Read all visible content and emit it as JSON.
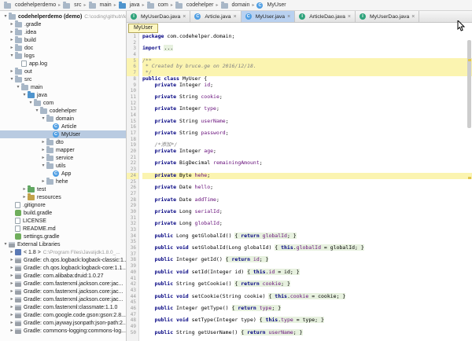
{
  "ui": {
    "close": "×",
    "collapsed": "▸",
    "expanded": "▾",
    "separator": "▸"
  },
  "colors": {
    "tab_selected": "#b9d1f0",
    "tree_selection": "#b9cbe1",
    "keyword": "#000080",
    "field": "#660e7a",
    "comment": "#808080",
    "line_highlight": "#fbf4b0",
    "fold_background": "#e7f1df"
  },
  "breadcrumb": {
    "items": [
      {
        "label": "codehelperdemo",
        "icon": "folder"
      },
      {
        "label": "src",
        "icon": "folder"
      },
      {
        "label": "main",
        "icon": "folder"
      },
      {
        "label": "java",
        "icon": "src"
      },
      {
        "label": "com",
        "icon": "pkg"
      },
      {
        "label": "codehelper",
        "icon": "pkg"
      },
      {
        "label": "domain",
        "icon": "pkg"
      },
      {
        "label": "MyUser",
        "icon": "class"
      }
    ]
  },
  "tabs": [
    {
      "label": "MyUserDao.java",
      "icon": "interface",
      "selected": false
    },
    {
      "label": "Article.java",
      "icon": "class",
      "selected": false
    },
    {
      "label": "MyUser.java",
      "icon": "class",
      "selected": true
    },
    {
      "label": "ArticleDao.java",
      "icon": "interface",
      "selected": false
    },
    {
      "label": "MyUserDao.java",
      "icon": "interface",
      "selected": false
    }
  ],
  "project": {
    "tree": [
      {
        "depth": 0,
        "state": "e",
        "icon": "folder",
        "label": "codehelperdemo (demo)",
        "sub": "C:\\coding\\github\\fe",
        "bold": true
      },
      {
        "depth": 1,
        "state": "c",
        "icon": "folder",
        "label": ".gradle"
      },
      {
        "depth": 1,
        "state": "c",
        "icon": "folder",
        "label": ".idea"
      },
      {
        "depth": 1,
        "state": "c",
        "icon": "folder",
        "label": "build"
      },
      {
        "depth": 1,
        "state": "c",
        "icon": "folder",
        "label": "doc"
      },
      {
        "depth": 1,
        "state": "e",
        "icon": "folder",
        "label": "logs"
      },
      {
        "depth": 2,
        "state": "n",
        "icon": "file",
        "label": "app.log"
      },
      {
        "depth": 1,
        "state": "c",
        "icon": "folder",
        "label": "out"
      },
      {
        "depth": 1,
        "state": "e",
        "icon": "folder",
        "label": "src"
      },
      {
        "depth": 2,
        "state": "e",
        "icon": "folder",
        "label": "main"
      },
      {
        "depth": 3,
        "state": "e",
        "icon": "src",
        "label": "java"
      },
      {
        "depth": 4,
        "state": "e",
        "icon": "pkg",
        "label": "com"
      },
      {
        "depth": 5,
        "state": "e",
        "icon": "pkg",
        "label": "codehelper"
      },
      {
        "depth": 6,
        "state": "e",
        "icon": "pkg",
        "label": "domain"
      },
      {
        "depth": 7,
        "state": "n",
        "icon": "class",
        "label": "Article"
      },
      {
        "depth": 7,
        "state": "n",
        "icon": "class",
        "label": "MyUser",
        "selected": true
      },
      {
        "depth": 6,
        "state": "c",
        "icon": "pkg",
        "label": "dto"
      },
      {
        "depth": 6,
        "state": "c",
        "icon": "pkg",
        "label": "mapper"
      },
      {
        "depth": 6,
        "state": "c",
        "icon": "pkg",
        "label": "service"
      },
      {
        "depth": 6,
        "state": "e",
        "icon": "pkg",
        "label": "utils"
      },
      {
        "depth": 7,
        "state": "n",
        "icon": "class",
        "label": "App"
      },
      {
        "depth": 6,
        "state": "c",
        "icon": "pkg",
        "label": "hehe"
      },
      {
        "depth": 3,
        "state": "c",
        "icon": "test",
        "label": "test"
      },
      {
        "depth": 3,
        "state": "c",
        "icon": "res",
        "label": "resources"
      },
      {
        "depth": 1,
        "state": "n",
        "icon": "file",
        "label": ".gitignore"
      },
      {
        "depth": 1,
        "state": "n",
        "icon": "gradle",
        "label": "build.gradle"
      },
      {
        "depth": 1,
        "state": "n",
        "icon": "file",
        "label": "LICENSE"
      },
      {
        "depth": 1,
        "state": "n",
        "icon": "file",
        "label": "README.md"
      },
      {
        "depth": 1,
        "state": "n",
        "icon": "gradle",
        "label": "settings.gradle"
      },
      {
        "depth": 0,
        "state": "e",
        "icon": "lib",
        "label": "External Libraries"
      },
      {
        "depth": 1,
        "state": "c",
        "icon": "jdk",
        "label": "< 1.8 >",
        "sub": "C:\\Program Files\\Java\\jdk1.8.0_..."
      },
      {
        "depth": 1,
        "state": "c",
        "icon": "lib",
        "label": "Gradle: ch.qos.logback:logback-classic:1..."
      },
      {
        "depth": 1,
        "state": "c",
        "icon": "lib",
        "label": "Gradle: ch.qos.logback:logback-core:1.1..."
      },
      {
        "depth": 1,
        "state": "c",
        "icon": "lib",
        "label": "Gradle: com.alibaba:druid:1.0.27"
      },
      {
        "depth": 1,
        "state": "c",
        "icon": "lib",
        "label": "Gradle: com.fasterxml.jackson.core:jac..."
      },
      {
        "depth": 1,
        "state": "c",
        "icon": "lib",
        "label": "Gradle: com.fasterxml.jackson.core:jac..."
      },
      {
        "depth": 1,
        "state": "c",
        "icon": "lib",
        "label": "Gradle: com.fasterxml.jackson.core:jac..."
      },
      {
        "depth": 1,
        "state": "c",
        "icon": "lib",
        "label": "Gradle: com.fasterxml:classmate:1.1.0"
      },
      {
        "depth": 1,
        "state": "c",
        "icon": "lib",
        "label": "Gradle: com.google.code.gson:gson:2.8..."
      },
      {
        "depth": 1,
        "state": "c",
        "icon": "lib",
        "label": "Gradle: com.jayway.jsonpath:json-path:2..."
      },
      {
        "depth": 1,
        "state": "c",
        "icon": "lib",
        "label": "Gradle: commons-logging:commons-log..."
      }
    ]
  },
  "editor": {
    "floating_label": "MyUser",
    "lines": [
      {
        "num": 1,
        "segs": [
          [
            "package",
            "kw"
          ],
          [
            " com.codehelper.domain;",
            "pl"
          ]
        ]
      },
      {
        "num": 2,
        "segs": []
      },
      {
        "num": 3,
        "segs": [
          [
            "import",
            "kw"
          ],
          [
            " ",
            "pl"
          ],
          [
            "...",
            "f"
          ]
        ]
      },
      {
        "num": 4,
        "segs": []
      },
      {
        "num": 5,
        "hl": true,
        "segs": [
          [
            "/**",
            "cmt"
          ]
        ]
      },
      {
        "num": 6,
        "hl": true,
        "segs": [
          [
            " * Created by bruce.ge on 2016/12/18.",
            "cmt"
          ]
        ]
      },
      {
        "num": 7,
        "hl": true,
        "segs": [
          [
            " */",
            "cmt"
          ]
        ]
      },
      {
        "num": 8,
        "segs": [
          [
            "public class",
            "kw"
          ],
          [
            " MyUser {",
            "pl"
          ]
        ]
      },
      {
        "num": 9,
        "segs": [
          [
            "    ",
            "pl"
          ],
          [
            "private",
            "kw"
          ],
          [
            " Integer ",
            "pl"
          ],
          [
            "id",
            "fld"
          ],
          [
            ";",
            "pl"
          ]
        ]
      },
      {
        "num": 10,
        "segs": []
      },
      {
        "num": 11,
        "segs": [
          [
            "    ",
            "pl"
          ],
          [
            "private",
            "kw"
          ],
          [
            " String ",
            "pl"
          ],
          [
            "cookie",
            "fld"
          ],
          [
            ";",
            "pl"
          ]
        ]
      },
      {
        "num": 12,
        "segs": []
      },
      {
        "num": 13,
        "segs": [
          [
            "    ",
            "pl"
          ],
          [
            "private",
            "kw"
          ],
          [
            " Integer ",
            "pl"
          ],
          [
            "type",
            "fld"
          ],
          [
            ";",
            "pl"
          ]
        ]
      },
      {
        "num": 14,
        "segs": []
      },
      {
        "num": 15,
        "segs": [
          [
            "    ",
            "pl"
          ],
          [
            "private",
            "kw"
          ],
          [
            " String ",
            "pl"
          ],
          [
            "userName",
            "fld"
          ],
          [
            ";",
            "pl"
          ]
        ]
      },
      {
        "num": 16,
        "segs": []
      },
      {
        "num": 17,
        "segs": [
          [
            "    ",
            "pl"
          ],
          [
            "private",
            "kw"
          ],
          [
            " String ",
            "pl"
          ],
          [
            "password",
            "fld"
          ],
          [
            ";",
            "pl"
          ]
        ]
      },
      {
        "num": 18,
        "segs": []
      },
      {
        "num": 19,
        "segs": [
          [
            "    ",
            "pl"
          ],
          [
            "/*添加*/",
            "cmt"
          ]
        ]
      },
      {
        "num": 20,
        "segs": [
          [
            "    ",
            "pl"
          ],
          [
            "private",
            "kw"
          ],
          [
            " Integer ",
            "pl"
          ],
          [
            "age",
            "fld"
          ],
          [
            ";",
            "pl"
          ]
        ]
      },
      {
        "num": 21,
        "segs": []
      },
      {
        "num": 22,
        "segs": [
          [
            "    ",
            "pl"
          ],
          [
            "private",
            "kw"
          ],
          [
            " BigDecimal ",
            "pl"
          ],
          [
            "remainingAmount",
            "fld"
          ],
          [
            ";",
            "pl"
          ]
        ]
      },
      {
        "num": 23,
        "segs": []
      },
      {
        "num": 24,
        "hl": true,
        "bulb": true,
        "segs": [
          [
            "    ",
            "pl"
          ],
          [
            "private",
            "kw"
          ],
          [
            " Byte ",
            "pl"
          ],
          [
            "hehe",
            "fld"
          ],
          [
            ";",
            "pl"
          ]
        ]
      },
      {
        "num": 25,
        "segs": []
      },
      {
        "num": 26,
        "segs": [
          [
            "    ",
            "pl"
          ],
          [
            "private",
            "kw"
          ],
          [
            " Date ",
            "pl"
          ],
          [
            "hello",
            "fld"
          ],
          [
            ";",
            "pl"
          ]
        ]
      },
      {
        "num": 27,
        "segs": []
      },
      {
        "num": 28,
        "segs": [
          [
            "    ",
            "pl"
          ],
          [
            "private",
            "kw"
          ],
          [
            " Date ",
            "pl"
          ],
          [
            "addTime",
            "fld"
          ],
          [
            ";",
            "pl"
          ]
        ]
      },
      {
        "num": 29,
        "segs": []
      },
      {
        "num": 30,
        "segs": [
          [
            "    ",
            "pl"
          ],
          [
            "private",
            "kw"
          ],
          [
            " Long ",
            "pl"
          ],
          [
            "serialId",
            "fld"
          ],
          [
            ";",
            "pl"
          ]
        ]
      },
      {
        "num": 31,
        "segs": []
      },
      {
        "num": 32,
        "segs": [
          [
            "    ",
            "pl"
          ],
          [
            "private",
            "kw"
          ],
          [
            " Long ",
            "pl"
          ],
          [
            "globalId",
            "fld"
          ],
          [
            ";",
            "pl"
          ]
        ]
      },
      {
        "num": 33,
        "segs": []
      },
      {
        "num": 34,
        "segs": [
          [
            "    ",
            "pl"
          ],
          [
            "public",
            "kw"
          ],
          [
            " Long getGlobalId() ",
            "pl"
          ],
          [
            "{ ",
            "f"
          ],
          [
            "return",
            "fk"
          ],
          [
            " ",
            "f"
          ],
          [
            "globalId",
            "ff"
          ],
          [
            "; }",
            "f"
          ]
        ]
      },
      {
        "num": 35,
        "segs": []
      },
      {
        "num": 36,
        "segs": [
          [
            "    ",
            "pl"
          ],
          [
            "public void",
            "kw"
          ],
          [
            " setGlobalId(Long globalId) ",
            "pl"
          ],
          [
            "{ ",
            "f"
          ],
          [
            "this",
            "fk"
          ],
          [
            ".",
            "f"
          ],
          [
            "globalId",
            "ff"
          ],
          [
            " = globalId; }",
            "f"
          ]
        ]
      },
      {
        "num": 37,
        "segs": []
      },
      {
        "num": 38,
        "segs": [
          [
            "    ",
            "pl"
          ],
          [
            "public",
            "kw"
          ],
          [
            " Integer getId() ",
            "pl"
          ],
          [
            "{ ",
            "f"
          ],
          [
            "return",
            "fk"
          ],
          [
            " ",
            "f"
          ],
          [
            "id",
            "ff"
          ],
          [
            "; }",
            "f"
          ]
        ]
      },
      {
        "num": 39,
        "segs": []
      },
      {
        "num": 40,
        "segs": [
          [
            "    ",
            "pl"
          ],
          [
            "public void",
            "kw"
          ],
          [
            " setId(Integer id) ",
            "pl"
          ],
          [
            "{ ",
            "f"
          ],
          [
            "this",
            "fk"
          ],
          [
            ".",
            "f"
          ],
          [
            "id",
            "ff"
          ],
          [
            " = id; }",
            "f"
          ]
        ]
      },
      {
        "num": 41,
        "segs": []
      },
      {
        "num": 42,
        "segs": [
          [
            "    ",
            "pl"
          ],
          [
            "public",
            "kw"
          ],
          [
            " String getCookie() ",
            "pl"
          ],
          [
            "{ ",
            "f"
          ],
          [
            "return",
            "fk"
          ],
          [
            " ",
            "f"
          ],
          [
            "cookie",
            "ff"
          ],
          [
            "; }",
            "f"
          ]
        ]
      },
      {
        "num": 43,
        "segs": []
      },
      {
        "num": 44,
        "segs": [
          [
            "    ",
            "pl"
          ],
          [
            "public void",
            "kw"
          ],
          [
            " setCookie(String cookie) ",
            "pl"
          ],
          [
            "{ ",
            "f"
          ],
          [
            "this",
            "fk"
          ],
          [
            ".",
            "f"
          ],
          [
            "cookie",
            "ff"
          ],
          [
            " = cookie; }",
            "f"
          ]
        ]
      },
      {
        "num": 45,
        "segs": []
      },
      {
        "num": 46,
        "segs": [
          [
            "    ",
            "pl"
          ],
          [
            "public",
            "kw"
          ],
          [
            " Integer getType() ",
            "pl"
          ],
          [
            "{ ",
            "f"
          ],
          [
            "return",
            "fk"
          ],
          [
            " ",
            "f"
          ],
          [
            "type",
            "ff"
          ],
          [
            "; }",
            "f"
          ]
        ]
      },
      {
        "num": 47,
        "segs": []
      },
      {
        "num": 48,
        "segs": [
          [
            "    ",
            "pl"
          ],
          [
            "public void",
            "kw"
          ],
          [
            " setType(Integer type) ",
            "pl"
          ],
          [
            "{ ",
            "f"
          ],
          [
            "this",
            "fk"
          ],
          [
            ".",
            "f"
          ],
          [
            "type",
            "ff"
          ],
          [
            " = type; }",
            "f"
          ]
        ]
      },
      {
        "num": 49,
        "segs": []
      },
      {
        "num": 50,
        "segs": [
          [
            "    ",
            "pl"
          ],
          [
            "public",
            "kw"
          ],
          [
            " String getUserName() ",
            "pl"
          ],
          [
            "{ ",
            "f"
          ],
          [
            "return",
            "fk"
          ],
          [
            " ",
            "f"
          ],
          [
            "userName",
            "ff"
          ],
          [
            "; }",
            "f"
          ]
        ]
      }
    ]
  }
}
